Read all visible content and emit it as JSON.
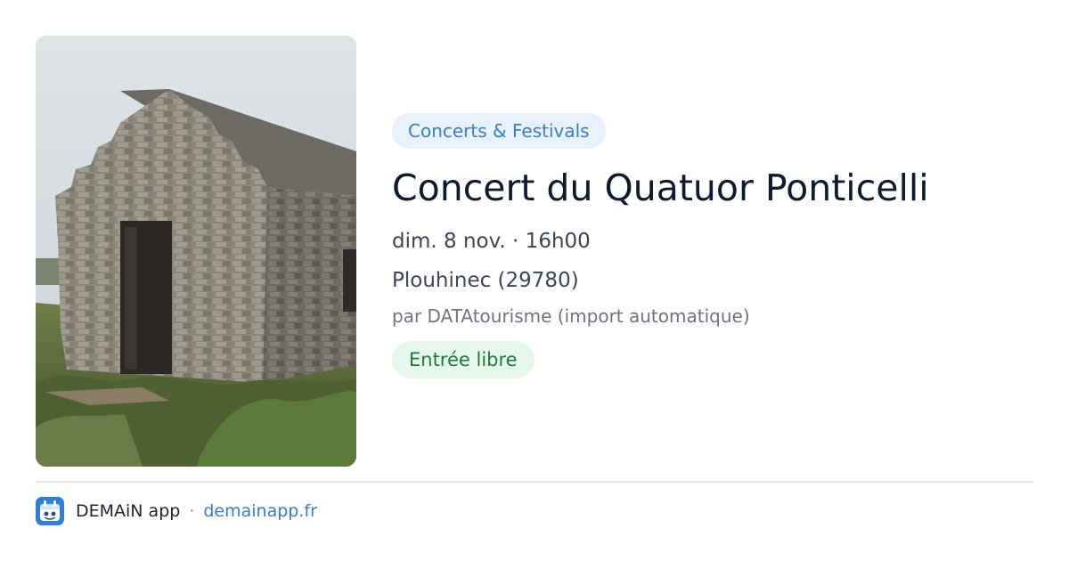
{
  "event": {
    "category": "Concerts & Festivals",
    "title": "Concert du Quatuor Ponticelli",
    "datetime": "dim. 8 nov. · 16h00",
    "location": "Plouhinec (29780)",
    "organizer": "par DATAtourisme (import automatique)",
    "price": "Entrée libre"
  },
  "footer": {
    "app_name": "DEMAiN app",
    "separator": "·",
    "url": "demainapp.fr"
  },
  "colors": {
    "accent": "#3b7dc9",
    "category_bg": "#e9f1fb",
    "price_text": "#1f7a3a",
    "price_bg": "#e7f7ec"
  },
  "icons": {
    "app_logo": "calendar-bot-icon"
  }
}
